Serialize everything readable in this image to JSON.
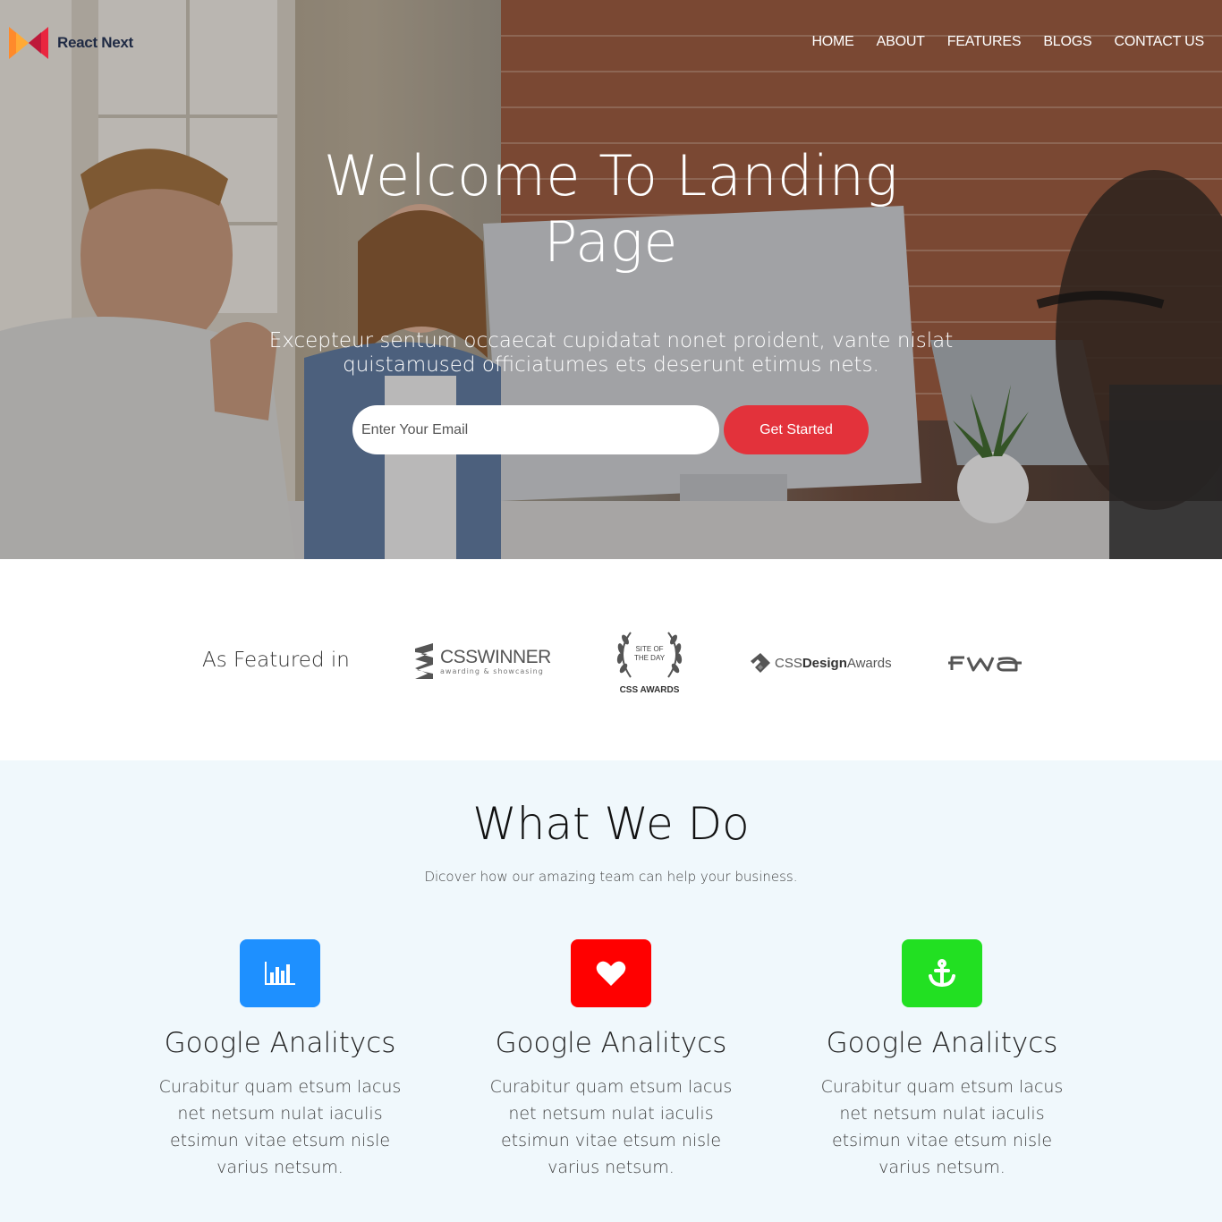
{
  "brand": {
    "name": "React Next"
  },
  "nav": [
    "HOME",
    "ABOUT",
    "FEATURES",
    "BLOGS",
    "CONTACT US"
  ],
  "hero": {
    "title": "Welcome To Landing Page",
    "subtitle": "Excepteur sentum occaecat cupidatat nonet proident, vante nislat quistamused officiatumes ets deserunt etimus nets.",
    "email_placeholder": "Enter Your Email",
    "cta_label": "Get Started"
  },
  "featured": {
    "label": "As Featured in",
    "logos": {
      "csswinner": {
        "name": "CSSWINNER",
        "tagline": "awarding & showcasing"
      },
      "cssawards": {
        "line1": "SITE OF",
        "line2": "THE DAY",
        "name": "CSS AWARDS"
      },
      "cssdesignawards": {
        "part1": "CSS",
        "part2": "Design",
        "part3": "Awards"
      },
      "fwa": {
        "name": "FWA"
      }
    }
  },
  "what_we_do": {
    "title": "What We Do",
    "subtitle": "Dicover how our amazing team can help your business.",
    "cards": [
      {
        "icon": "bar-chart-icon",
        "color": "#1e90ff",
        "title": "Google Analitycs",
        "text": "Curabitur quam etsum lacus net netsum nulat iaculis etsimun vitae etsum nisle varius netsum."
      },
      {
        "icon": "heart-icon",
        "color": "#ff0000",
        "title": "Google Analitycs",
        "text": "Curabitur quam etsum lacus net netsum nulat iaculis etsimun vitae etsum nisle varius netsum."
      },
      {
        "icon": "anchor-icon",
        "color": "#22e022",
        "title": "Google Analitycs",
        "text": "Curabitur quam etsum lacus net netsum nulat iaculis etsimun vitae etsum nisle varius netsum."
      }
    ]
  }
}
